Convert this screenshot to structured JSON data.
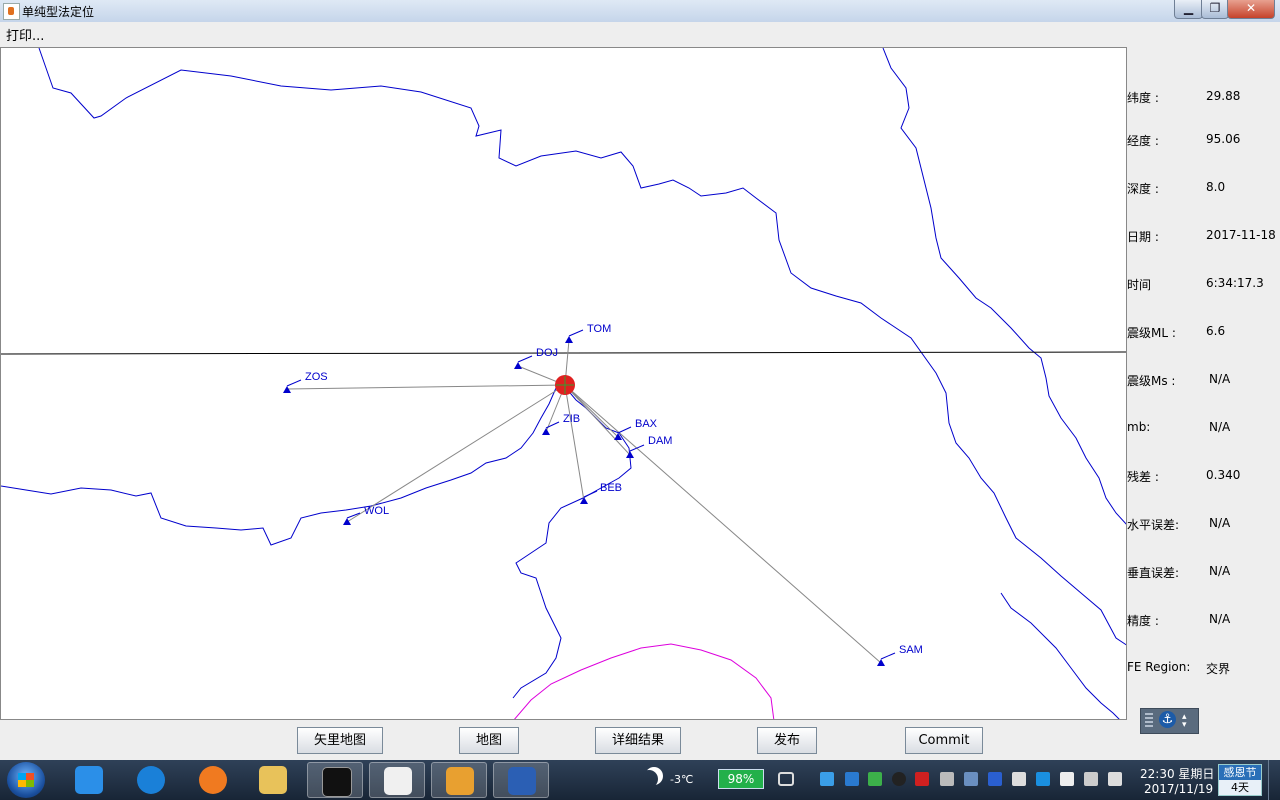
{
  "window": {
    "title": "单纯型法定位",
    "minimize": "▁",
    "maximize": "❐",
    "close": "✕"
  },
  "menu": {
    "print": "打印..."
  },
  "map": {
    "epicenter_color": "#e02020",
    "station_color": "#0000cc",
    "stations": [
      "TOM",
      "DOJ",
      "ZOS",
      "ZIB",
      "BAX",
      "DAM",
      "BEB",
      "WOL",
      "SAM"
    ]
  },
  "info": [
    {
      "label": "纬度 :",
      "value": "29.88"
    },
    {
      "label": "经度 :",
      "value": "95.06"
    },
    {
      "label": "深度 :",
      "value": "8.0"
    },
    {
      "label": "日期 :",
      "value": "2017-11-18"
    },
    {
      "label": "时间",
      "value": "6:34:17.3"
    },
    {
      "label": "震级ML :",
      "value": "6.6"
    },
    {
      "label": "震级Ms :",
      "value": "N/A"
    },
    {
      "label": "mb:",
      "value": "N/A"
    },
    {
      "label": "残差 :",
      "value": "0.340"
    },
    {
      "label": "水平误差:",
      "value": "N/A"
    },
    {
      "label": "垂直误差:",
      "value": "N/A"
    },
    {
      "label": "精度 :",
      "value": "N/A"
    },
    {
      "label": "FE Region:",
      "value": "交界"
    }
  ],
  "buttons": {
    "vector_map": "矢里地图",
    "map": "地图",
    "details": "详细结果",
    "publish": "发布",
    "commit": "Commit"
  },
  "taskbar": {
    "temperature": "-3℃",
    "battery": "98%",
    "time": "22:30 星期日",
    "date": "2017/11/19",
    "holiday_name": "感恩节",
    "holiday_days": "4天"
  }
}
